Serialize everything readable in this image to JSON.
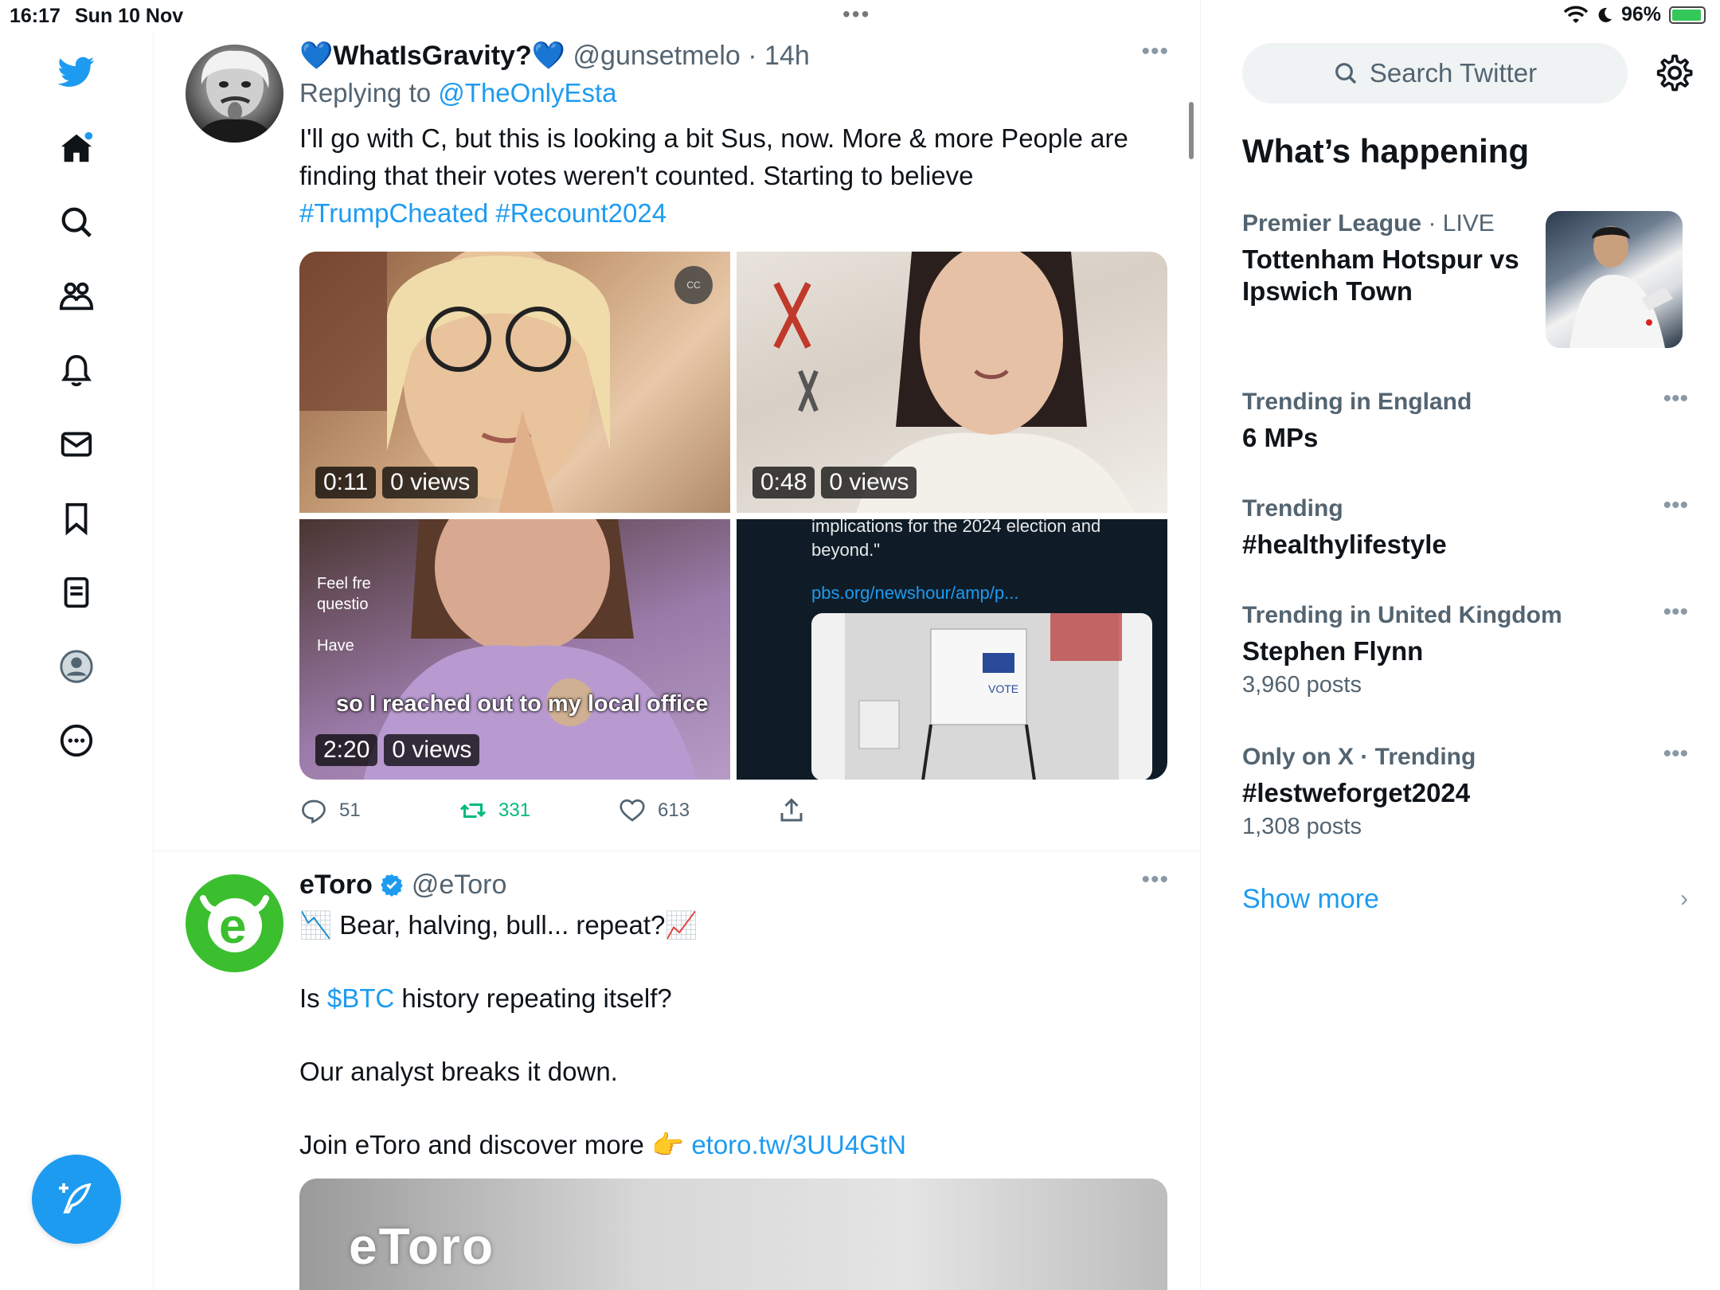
{
  "status_bar": {
    "time": "16:17",
    "date": "Sun 10 Nov",
    "battery": "96%"
  },
  "colors": {
    "accent": "#1d9bf0",
    "retweet_green": "#00ba7c",
    "secondary_text": "#536471"
  },
  "nav": {
    "icons": [
      "twitter-logo-icon",
      "home-icon",
      "search-icon",
      "communities-icon",
      "notifications-icon",
      "messages-icon",
      "bookmarks-icon",
      "lists-icon",
      "profile-icon",
      "more-icon"
    ],
    "compose_icon": "compose-icon"
  },
  "tweets": [
    {
      "name": "💙WhatIsGravity?💙",
      "handle": "@gunsetmelo",
      "time": "· 14h",
      "reply_prefix": "Replying to",
      "reply_to": "@TheOnlyEsta",
      "text": "I'll go with C, but this is looking a bit Sus, now. More & more People are finding that their votes weren't counted. Starting to believe",
      "hashtags": "#TrumpCheated #Recount2024",
      "media": [
        {
          "duration": "0:11",
          "views": "0 views"
        },
        {
          "duration": "0:48",
          "views": "0 views"
        },
        {
          "duration": "2:20",
          "views": "0 views",
          "caption": "so I reached out to my local office",
          "side_text_1": "Feel fre",
          "side_text_2": "questio",
          "side_text_3": "Have"
        },
        {
          "quote_text": "implications for the 2024 election and beyond.\"",
          "link": "pbs.org/newshour/amp/p...",
          "ballot_label": "VOTE"
        }
      ],
      "stats": {
        "replies": "51",
        "retweets": "331",
        "likes": "613"
      }
    },
    {
      "name": "eToro",
      "handle": "@eToro",
      "line1": "📉 Bear, halving, bull... repeat?📈",
      "line2_prefix": "Is",
      "cashtag": "$BTC",
      "line2_suffix": "history repeating itself?",
      "line3": "Our analyst breaks it down.",
      "line4_prefix": "Join eToro and discover more 👉",
      "line4_link": "etoro.tw/3UU4GtN",
      "media_logo": "eToro"
    }
  ],
  "sidebar": {
    "search_placeholder": "Search Twitter",
    "section_title": "What’s happening",
    "trends": [
      {
        "meta": "Premier League",
        "meta_extra": "· LIVE",
        "title": "Tottenham Hotspur vs Ipswich Town",
        "count": ""
      },
      {
        "meta": "Trending in England",
        "meta_extra": "",
        "title": "6 MPs",
        "count": ""
      },
      {
        "meta": "Trending",
        "meta_extra": "",
        "title": "#healthylifestyle",
        "count": ""
      },
      {
        "meta": "Trending in United Kingdom",
        "meta_extra": "",
        "title": "Stephen Flynn",
        "count": "3,960 posts"
      },
      {
        "meta": "Only on X · Trending",
        "meta_extra": "",
        "title": "#lestweforget2024",
        "count": "1,308 posts"
      }
    ],
    "show_more": "Show more"
  }
}
